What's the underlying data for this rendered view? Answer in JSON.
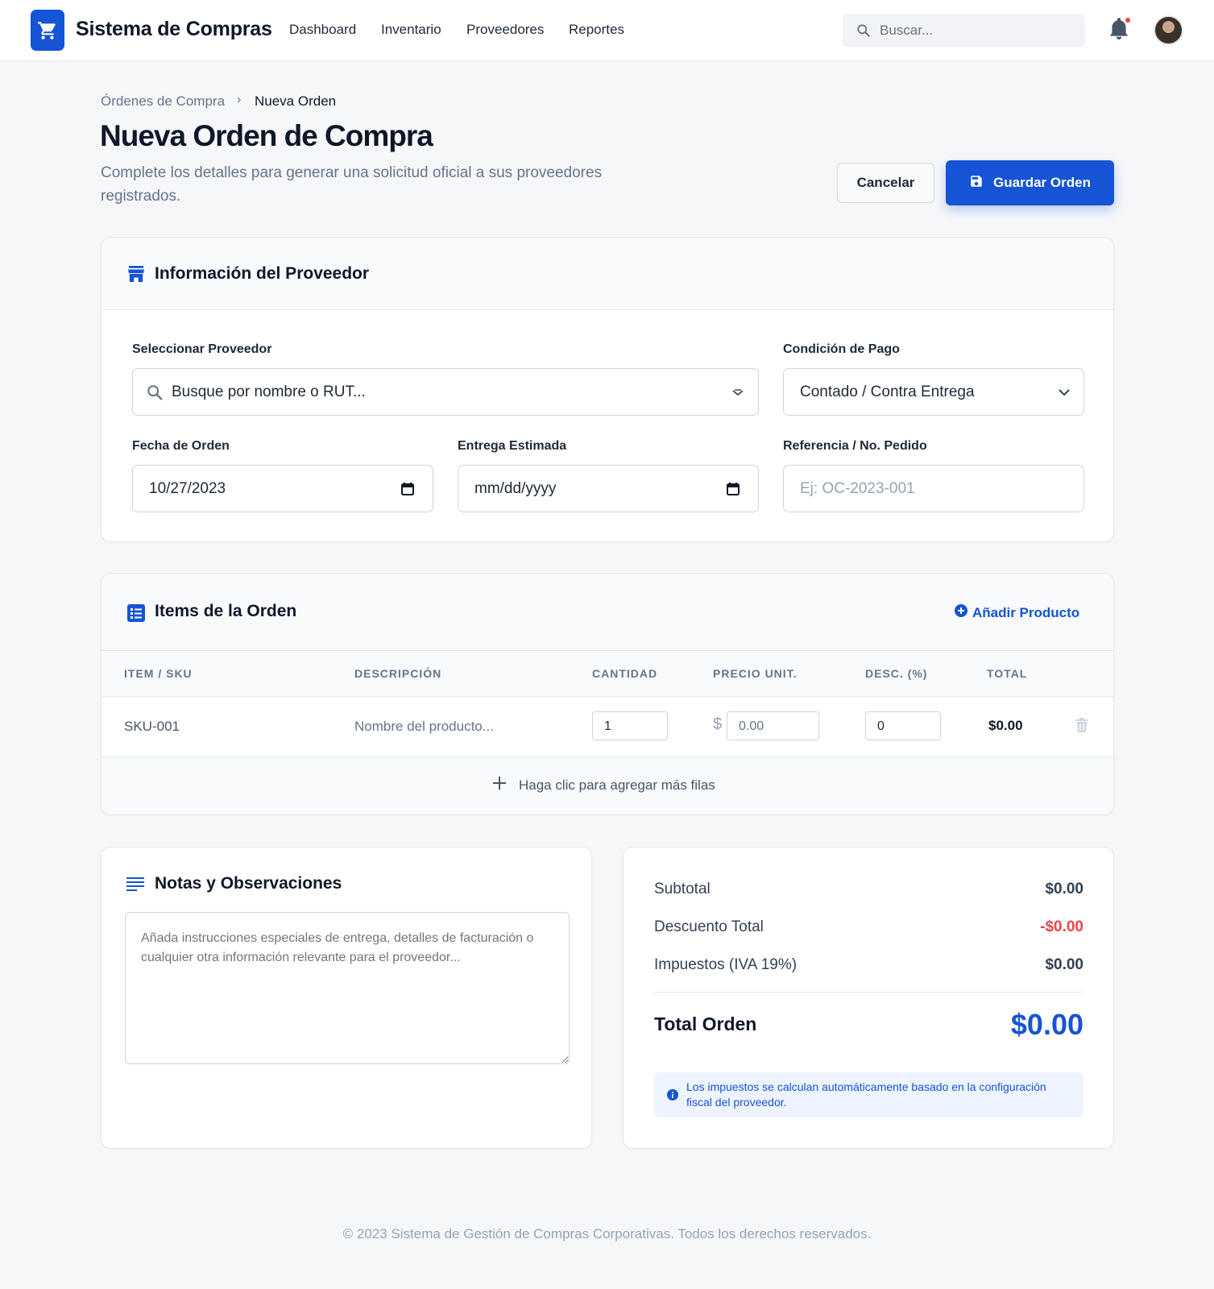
{
  "app": {
    "name": "Sistema de Compras",
    "nav": [
      "Dashboard",
      "Inventario",
      "Proveedores",
      "Reportes"
    ],
    "search_placeholder": "Buscar..."
  },
  "header": {
    "breadcrumb": [
      "Órdenes de Compra",
      "Nueva Orden"
    ],
    "breadcrumb_separator": "›",
    "title": "Nueva Orden de Compra",
    "subtitle": "Complete los detalles para generar una solicitud oficial a sus proveedores registrados.",
    "cancel_label": "Cancelar",
    "save_label": "Guardar Orden"
  },
  "supplier": {
    "title": "Información del Proveedor",
    "provider_label": "Seleccionar Proveedor",
    "provider_placeholder": "Busque por nombre o RUT...",
    "payment_label": "Condición de Pago",
    "payment_value": "Contado / Contra Entrega",
    "order_date_label": "Fecha de Orden",
    "order_date_value": "10/27/2023",
    "delivery_label": "Entrega Estimada",
    "delivery_value": "mm/dd/yyyy",
    "reference_label": "Referencia / No. Pedido",
    "reference_placeholder": "Ej: OC-2023-001"
  },
  "items": {
    "title": "Items de la Orden",
    "add_label": "Añadir Producto",
    "columns": [
      "ITEM / SKU",
      "DESCRIPCIÓN",
      "CANTIDAD",
      "PRECIO UNIT.",
      "DESC. (%)",
      "TOTAL"
    ],
    "rows": [
      {
        "sku": "SKU-001",
        "description": "Nombre del producto...",
        "quantity": "1",
        "currency": "$",
        "price_placeholder": "0.00",
        "discount": "0",
        "total": "$0.00"
      }
    ],
    "add_row_label": "Haga clic para agregar más filas"
  },
  "notes": {
    "title": "Notas y Observaciones",
    "placeholder": "Añada instrucciones especiales de entrega, detalles de facturación o cualquier otra información relevante para el proveedor..."
  },
  "summary": {
    "subtotal_label": "Subtotal",
    "subtotal_value": "$0.00",
    "discount_label": "Descuento Total",
    "discount_value": "-$0.00",
    "tax_label": "Impuestos (IVA 19%)",
    "tax_value": "$0.00",
    "total_label": "Total Orden",
    "total_value": "$0.00",
    "info_text": "Los impuestos se calculan automáticamente basado en la configuración fiscal del proveedor."
  },
  "footer": {
    "text": "© 2023 Sistema de Gestión de Compras Corporativas. Todos los derechos reservados."
  },
  "colors": {
    "primary": "#1554d4",
    "danger": "#ef4444",
    "muted": "#64748b"
  }
}
